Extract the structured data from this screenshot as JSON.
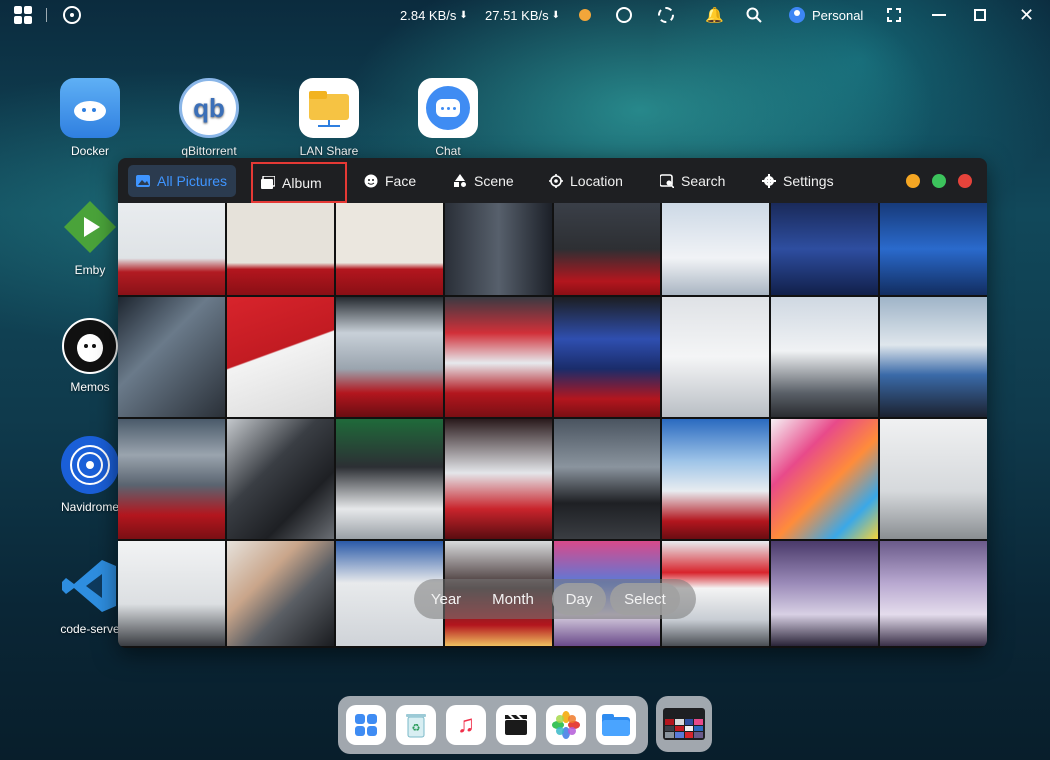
{
  "topbar": {
    "download_speed": "2.84 KB/s",
    "upload_speed": "27.51 KB/s",
    "user": "Personal"
  },
  "desktop": {
    "icons": [
      {
        "label": "Docker",
        "icon": "docker-icon"
      },
      {
        "label": "qBittorrent",
        "icon": "qbittorrent-icon",
        "glyph": "qb"
      },
      {
        "label": "LAN Share",
        "icon": "lan-share-icon"
      },
      {
        "label": "Chat",
        "icon": "chat-icon"
      },
      {
        "label": "Emby",
        "icon": "emby-icon"
      },
      {
        "label": "Memos",
        "icon": "memos-icon"
      },
      {
        "label": "Navidrome",
        "icon": "navidrome-icon"
      },
      {
        "label": "code-serve",
        "icon": "vscode-icon"
      }
    ]
  },
  "photos_app": {
    "nav": {
      "all_pictures": "All Pictures",
      "album": "Album",
      "face": "Face",
      "scene": "Scene",
      "location": "Location",
      "search": "Search",
      "settings": "Settings"
    },
    "window_controls": {
      "minimize_color": "#f5a623",
      "maximize_color": "#3cc35c",
      "close_color": "#e5433b"
    },
    "view_modes": [
      "Year",
      "Month",
      "Day",
      "Select"
    ],
    "selected_view": "Day"
  },
  "dock": {
    "apps": [
      "launcher-icon",
      "recycle-bin-icon",
      "music-icon",
      "video-icon",
      "photos-icon",
      "files-icon"
    ]
  },
  "colors": {
    "accent": "#3f95ff",
    "highlight_border": "#e53935"
  }
}
